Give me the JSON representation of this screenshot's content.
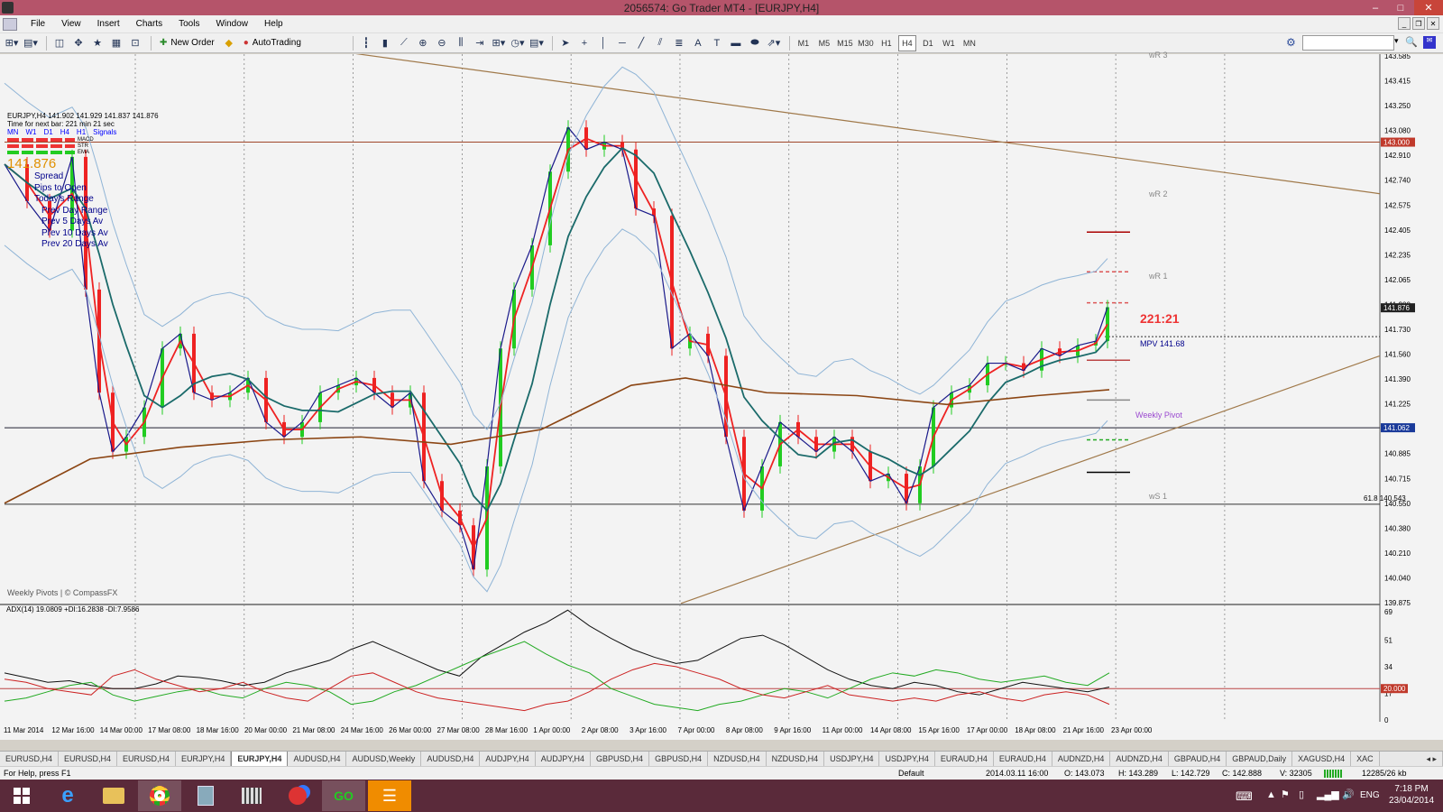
{
  "window": {
    "title": "2056574: Go Trader MT4 - [EURJPY,H4]"
  },
  "menu": [
    "File",
    "View",
    "Insert",
    "Charts",
    "Tools",
    "Window",
    "Help"
  ],
  "toolbar": {
    "new_order": "New Order",
    "autotrading": "AutoTrading",
    "timeframes": [
      "M1",
      "M5",
      "M15",
      "M30",
      "H1",
      "H4",
      "D1",
      "W1",
      "MN"
    ],
    "active_timeframe": "H4"
  },
  "chart": {
    "symbol_line": "EURJPY,H4  141.902 141.929 141.837 141.876",
    "timer_line": "Time for next bar: 221 min 21 sec",
    "signal_headers": [
      "MN",
      "W1",
      "D1",
      "H4",
      "H1",
      "Signals"
    ],
    "signal_rows": [
      "MACD",
      "STR",
      "EMA"
    ],
    "big_price": "141.876",
    "info_items": [
      "Spread",
      "Pips to Open",
      "Today's Range",
      "Prev Day Range",
      "Prev 5 Days Av",
      "Prev 10 Days Av",
      "Prev 20 Days Av"
    ],
    "footer": "Weekly Pivots | © CompassFX",
    "countdown": "221:21",
    "mpv": "MPV  141.68",
    "pivot_labels": {
      "wr3": "wR 3",
      "wr2": "wR 2",
      "wr1": "wR 1",
      "pivot": "Weekly Pivot",
      "ws1": "wS 1"
    },
    "fib_label": "61.8  140.543",
    "price_axis": [
      "143.585",
      "143.415",
      "143.250",
      "143.080",
      "142.910",
      "142.740",
      "142.575",
      "142.405",
      "142.235",
      "142.065",
      "141.900",
      "141.730",
      "141.560",
      "141.390",
      "141.225",
      "141.055",
      "140.885",
      "140.715",
      "140.550",
      "140.380",
      "140.210",
      "140.040",
      "139.875"
    ],
    "price_badges": {
      "level_red": "143.000",
      "current": "141.876",
      "level_blue": "141.062"
    },
    "time_axis": [
      "11 Mar 2014",
      "12 Mar 16:00",
      "14 Mar 00:00",
      "17 Mar 08:00",
      "18 Mar 16:00",
      "20 Mar 00:00",
      "21 Mar 08:00",
      "24 Mar 16:00",
      "26 Mar 00:00",
      "27 Mar 08:00",
      "28 Mar 16:00",
      "1 Apr 00:00",
      "2 Apr 08:00",
      "3 Apr 16:00",
      "7 Apr 00:00",
      "8 Apr 08:00",
      "9 Apr 16:00",
      "11 Apr 00:00",
      "14 Apr 08:00",
      "15 Apr 16:00",
      "17 Apr 00:00",
      "18 Apr 08:00",
      "21 Apr 16:00",
      "23 Apr 00:00"
    ],
    "adx_label": "ADX(14) 19.0809 +DI:16.2838 -DI:7.9586",
    "adx_axis": [
      "69",
      "51",
      "34",
      "17",
      "0"
    ],
    "adx_badge": "20.000"
  },
  "tabs": [
    "EURUSD,H4",
    "EURUSD,H4",
    "EURUSD,H4",
    "EURJPY,H4",
    "EURJPY,H4",
    "AUDUSD,H4",
    "AUDUSD,Weekly",
    "AUDUSD,H4",
    "AUDJPY,H4",
    "AUDJPY,H4",
    "GBPUSD,H4",
    "GBPUSD,H4",
    "NZDUSD,H4",
    "NZDUSD,H4",
    "USDJPY,H4",
    "USDJPY,H4",
    "EURAUD,H4",
    "EURAUD,H4",
    "AUDNZD,H4",
    "AUDNZD,H4",
    "GBPAUD,H4",
    "GBPAUD,Daily",
    "XAGUSD,H4",
    "XAC"
  ],
  "active_tab_index": 4,
  "status": {
    "help": "For Help, press F1",
    "profile": "Default",
    "datetime": "2014.03.11 16:00",
    "open": "O: 143.073",
    "high": "H: 143.289",
    "low": "L: 142.729",
    "close": "C: 142.888",
    "volume": "V: 32305",
    "traffic": "12285/26 kb"
  },
  "taskbar": {
    "lang": "ENG",
    "time": "7:18 PM",
    "date": "23/04/2014"
  }
}
